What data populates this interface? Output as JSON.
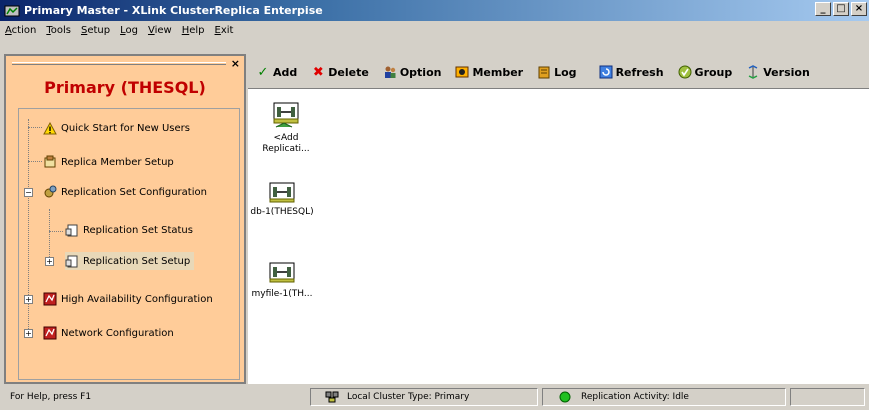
{
  "window": {
    "title": "Primary Master - XLink ClusterReplica Enterpise",
    "minimize": "_",
    "maximize": "□",
    "close": "×"
  },
  "menu": [
    "Action",
    "Tools",
    "Setup",
    "Log",
    "View",
    "Help",
    "Exit"
  ],
  "left_panel": {
    "title": "Primary (THESQL)",
    "close": "×",
    "tree": [
      {
        "label": "Quick Start for New Users",
        "icon": "warning-icon"
      },
      {
        "label": "Replica Member Setup",
        "icon": "member-setup-icon"
      },
      {
        "label": "Replication Set Configuration",
        "icon": "config-gear-icon"
      },
      {
        "label": "Replication Set Status",
        "icon": "status-doc-icon"
      },
      {
        "label": "Replication Set Setup",
        "icon": "setup-doc-icon"
      },
      {
        "label": "High Availability Configuration",
        "icon": "ha-config-icon"
      },
      {
        "label": "Network Configuration",
        "icon": "network-config-icon"
      }
    ]
  },
  "toolbar": {
    "add": "Add",
    "delete": "Delete",
    "option": "Option",
    "member": "Member",
    "log": "Log",
    "refresh": "Refresh",
    "group": "Group",
    "version": "Version"
  },
  "content": {
    "items": [
      {
        "label": "<Add Replicati...",
        "icon": "add-replication-icon"
      },
      {
        "label": "db-1(THESQL)",
        "icon": "replication-set-icon"
      },
      {
        "label": "myfile-1(TH...",
        "icon": "replication-set-icon"
      }
    ]
  },
  "status": {
    "help": "For Help, press F1",
    "cluster": "Local Cluster Type: Primary",
    "activity": "Replication Activity: Idle"
  }
}
